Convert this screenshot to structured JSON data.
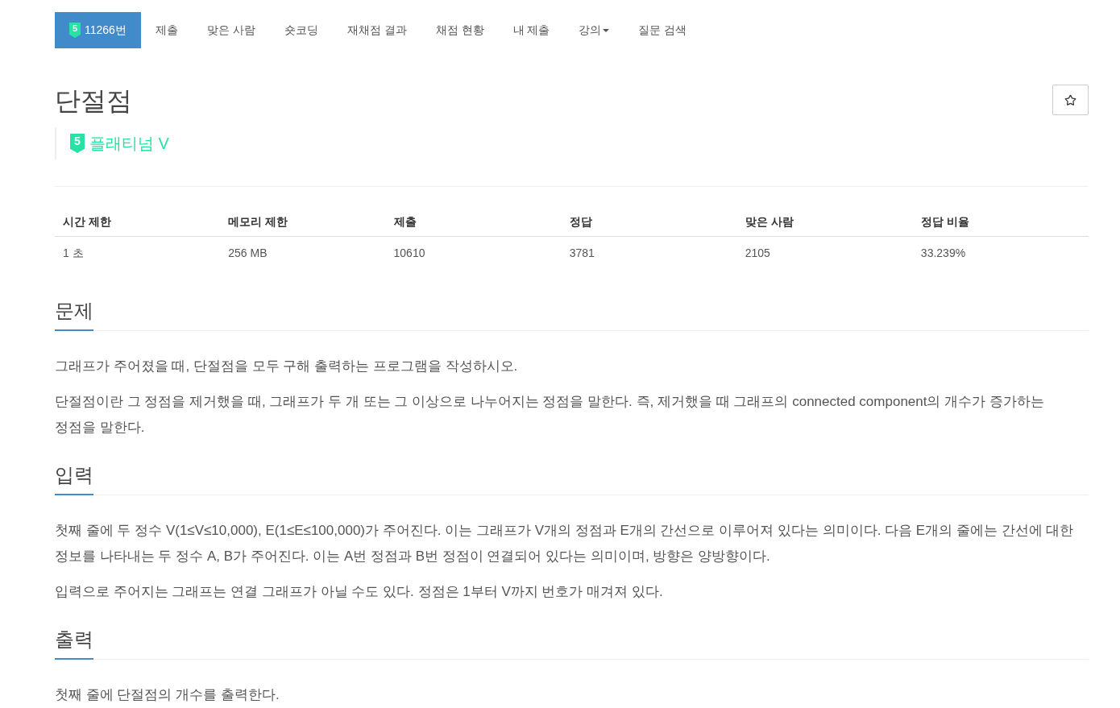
{
  "nav": {
    "tabs": [
      {
        "label": "11266번",
        "badge": "5",
        "selected": true,
        "has_menu": false
      },
      {
        "label": "제출",
        "selected": false,
        "has_menu": false
      },
      {
        "label": "맞은 사람",
        "selected": false,
        "has_menu": false
      },
      {
        "label": "숏코딩",
        "selected": false,
        "has_menu": false
      },
      {
        "label": "재채점 결과",
        "selected": false,
        "has_menu": false
      },
      {
        "label": "채점 현황",
        "selected": false,
        "has_menu": false
      },
      {
        "label": "내 제출",
        "selected": false,
        "has_menu": false
      },
      {
        "label": "강의",
        "selected": false,
        "has_menu": true
      },
      {
        "label": "질문 검색",
        "selected": false,
        "has_menu": false
      }
    ]
  },
  "problem": {
    "title": "단절점",
    "tier": {
      "badge": "5",
      "label": "플래티넘 V"
    }
  },
  "stats": {
    "columns": [
      "시간 제한",
      "메모리 제한",
      "제출",
      "정답",
      "맞은 사람",
      "정답 비율"
    ],
    "rows": [
      [
        "1 초",
        "256 MB",
        "10610",
        "3781",
        "2105",
        "33.239%"
      ]
    ]
  },
  "sections": [
    {
      "title": "문제",
      "paragraphs": [
        "그래프가 주어졌을 때, 단절점을 모두 구해 출력하는 프로그램을 작성하시오.",
        "단절점이란 그 정점을 제거했을 때, 그래프가 두 개 또는 그 이상으로 나누어지는 정점을 말한다. 즉, 제거했을 때 그래프의 connected component의 개수가 증가하는 정점을 말한다."
      ]
    },
    {
      "title": "입력",
      "paragraphs": [
        "첫째 줄에 두 정수 V(1≤V≤10,000), E(1≤E≤100,000)가 주어진다. 이는 그래프가 V개의 정점과 E개의 간선으로 이루어져 있다는 의미이다. 다음 E개의 줄에는 간선에 대한 정보를 나타내는 두 정수 A, B가 주어진다. 이는 A번 정점과 B번 정점이 연결되어 있다는 의미이며, 방향은 양방향이다.",
        "입력으로 주어지는 그래프는 연결 그래프가 아닐 수도 있다. 정점은 1부터 V까지 번호가 매겨져 있다."
      ]
    },
    {
      "title": "출력",
      "paragraphs": [
        "첫째 줄에 단절점의 개수를 출력한다."
      ]
    }
  ]
}
